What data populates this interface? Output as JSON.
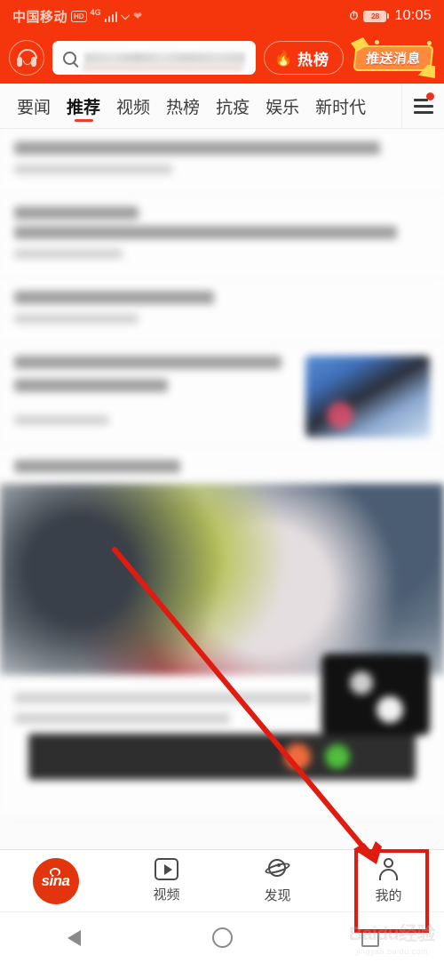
{
  "status_bar": {
    "carrier": "中国移动",
    "hd_badge": "HD",
    "network": "4G",
    "battery_level": "28",
    "time": "10:05",
    "icons": [
      "signal-bars-icon",
      "wifi-icon",
      "heart-icon",
      "alarm-clock-icon",
      "battery-icon"
    ]
  },
  "header": {
    "headphone_icon": "headphone-icon",
    "search": {
      "placeholder": "",
      "value": ""
    },
    "hot_button": {
      "label": "热榜",
      "icon": "flame-icon"
    },
    "push_banner": {
      "label": "推送消息",
      "icon": "megaphone-icon"
    },
    "background_color": "#F5360D"
  },
  "tabs": {
    "items": [
      {
        "label": "要闻",
        "active": false
      },
      {
        "label": "推荐",
        "active": true
      },
      {
        "label": "视频",
        "active": false
      },
      {
        "label": "热榜",
        "active": false
      },
      {
        "label": "抗疫",
        "active": false
      },
      {
        "label": "娱乐",
        "active": false
      },
      {
        "label": "新时代",
        "active": false
      }
    ],
    "menu_icon": "hamburger-menu-icon",
    "menu_badge": true,
    "active_indicator_color": "#e7402e"
  },
  "feed": {
    "note": "content is blurred / unreadable in screenshot",
    "cards": [
      {
        "type": "text-lines"
      },
      {
        "type": "text-with-thumbnail"
      },
      {
        "type": "large-photo"
      },
      {
        "type": "dark-media-card"
      }
    ]
  },
  "bottom_nav": {
    "items": [
      {
        "label": "",
        "icon": "sina-logo-icon",
        "logo_text": "sina",
        "active": false
      },
      {
        "label": "视频",
        "icon": "video-icon",
        "active": false
      },
      {
        "label": "发现",
        "icon": "discover-planet-icon",
        "active": false
      },
      {
        "label": "我的",
        "icon": "user-profile-icon",
        "active": false,
        "highlighted": true
      }
    ]
  },
  "android_nav": {
    "back": "back-triangle-icon",
    "home": "home-circle-icon",
    "recents": "recents-square-icon"
  },
  "annotation": {
    "box_color": "#e01b0f",
    "arrow_color": "#e01b0f",
    "target": "我的"
  },
  "watermark": {
    "main": "Baidu经验",
    "sub": "jingyan.baidu.com"
  }
}
